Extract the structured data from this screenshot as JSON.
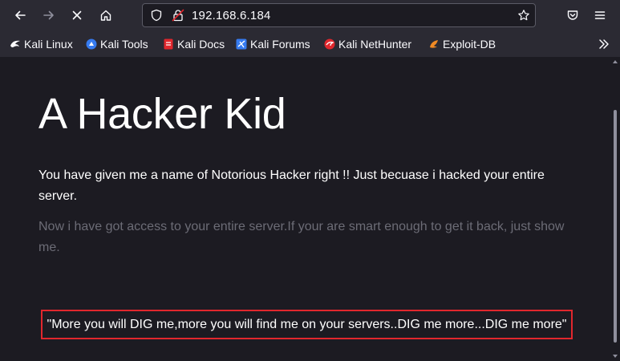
{
  "toolbar": {
    "url": "192.168.6.184"
  },
  "bookmarks": [
    {
      "label": "Kali Linux",
      "color": "#ffffff"
    },
    {
      "label": "Kali Tools",
      "color": "#367bf0"
    },
    {
      "label": "Kali Docs",
      "color": "#e1272d"
    },
    {
      "label": "Kali Forums",
      "color": "#367bf0"
    },
    {
      "label": "Kali NetHunter",
      "color": "#e1272d"
    },
    {
      "label": "Exploit-DB",
      "color": "#f08a24"
    }
  ],
  "page": {
    "title": "A Hacker Kid",
    "lead": "You have given me a name of Notorious Hacker right !! Just becuase i hacked your entire server.",
    "muted": "Now i have got access to your entire server.If your are smart enough to get it back, just show me.",
    "quote": "\"More you will DIG me,more you will find me on your servers..DIG me more...DIG me more\""
  },
  "colors": {
    "highlight_border": "#e1272d",
    "background": "#1c1b22",
    "chrome": "#2b2a33"
  }
}
